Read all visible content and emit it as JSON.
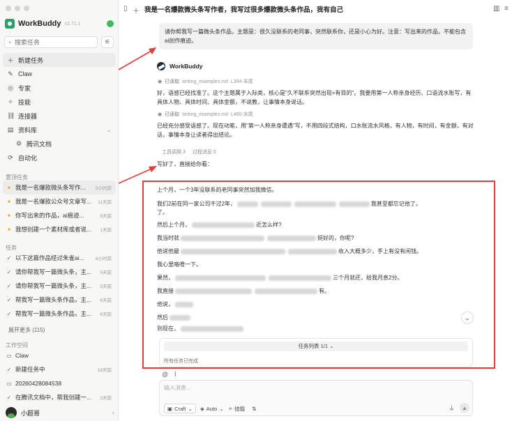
{
  "sidebar": {
    "brand": "WorkBuddy",
    "version": "v2.71.1",
    "search_placeholder": "搜索任务",
    "nav": [
      {
        "label": "新建任务",
        "icon": "plus-icon"
      },
      {
        "label": "Claw",
        "icon": "claw-icon"
      },
      {
        "label": "专家",
        "icon": "expert-icon"
      },
      {
        "label": "技能",
        "icon": "skill-icon"
      },
      {
        "label": "连接器",
        "icon": "connector-icon"
      },
      {
        "label": "资料库",
        "icon": "library-icon"
      },
      {
        "label": "腾讯文档",
        "icon": "doc-icon"
      },
      {
        "label": "自动化",
        "icon": "automation-icon"
      }
    ],
    "pinned_label": "置顶任务",
    "pinned": [
      {
        "text": "我是一名爆款微头条写作...",
        "time": "5小时前"
      },
      {
        "text": "我是一名爆款公众号文章写...",
        "time": "11天前"
      },
      {
        "text": "你写出来的作品，ai痕迹...",
        "time": "5天前"
      },
      {
        "text": "我想创建一个素材库或者说...",
        "time": "1天前"
      }
    ],
    "tasks_label": "任务",
    "tasks": [
      {
        "text": "以下这篇作品经过朱雀ai...",
        "time": "6小时前"
      },
      {
        "text": "请你帮我写一篇微头条，主...",
        "time": "5天前"
      },
      {
        "text": "请你帮我写一篇微头条，主...",
        "time": "5天前"
      },
      {
        "text": "帮我写一篇微头条作品，主...",
        "time": "6天前"
      },
      {
        "text": "帮我写一篇微头条作品，主...",
        "time": "6天前"
      }
    ],
    "show_more": "展开更多 (115)",
    "workspace_label": "工作空间",
    "workspace": [
      {
        "text": "Claw",
        "time": "",
        "icon": "folder-icon"
      },
      {
        "text": "新建任务中",
        "time": "18天前",
        "icon": "check-icon"
      },
      {
        "text": "20260428084538",
        "time": "",
        "icon": "folder-icon"
      },
      {
        "text": "在腾讯文档中，帮我创建一...",
        "time": "3天前",
        "icon": "check-icon"
      }
    ],
    "user_name": "小超哥"
  },
  "main": {
    "title": "我是一名爆款微头条写作者，我写过很多爆款微头条作品，我有自己",
    "user_message": "请你帮我写一篇微头条作品，主题是：很久没联系的老同事，突然联系你，还是小心为好。注意：写出来的作品，不能包含ai创作痕迹。",
    "bot_name": "WorkBuddy",
    "read1_label": "已读取",
    "read1_file": "writing_examples.md",
    "read1_range": "L394-末尾",
    "para1": "好，语感已经找准了。这个主题属于入际类，核心是\"久不联系突然出现=有目的\"。我要用第一人称亲身经历、口语流水账写，有具体人物、具体时间、具体金额，不说教，让事情本身说话。",
    "read2_label": "已读取",
    "read2_file": "writing_examples.md",
    "read2_range": "L460-末尾",
    "para2": "已经充分感受语感了。现在动笔，用\"第一人称亲身遭遇\"写，不用四段式结构，口水账流水风格，有人物，有时间，有金额，有对话，事情本身让读者得出结论。",
    "tool_calls": "工具调用 3",
    "process_msgs": "过程消息 0",
    "reply_intro": "写好了，直接给你看：",
    "story": [
      "上个月，一个3年没联系的老同事突然加我微信。",
      "我们2前在同一家公司干过2年，",
      "我甚至都忘记他了。",
      "然后上个月，",
      "近怎么样?",
      "我当时就",
      "挺好的，你呢?",
      "他说他最",
      "收入大概多少，手上有没有闲钱。",
      "我心里咯噔一下。",
      "果然，",
      "三个月就还，给我月息2分。",
      "我直接",
      "有。",
      "他说，",
      "然后",
      "到现在，"
    ],
    "task_list_header": "任务列表 1/1",
    "task_status": "所有任务已完成",
    "composer_placeholder": "输入消息...",
    "mode_label": "Craft",
    "model_label": "Auto",
    "skill_label": "技能"
  },
  "colors": {
    "accent_green": "#2f9e6e",
    "highlight_red": "#e53b3b",
    "pin_orange": "#e8a317"
  }
}
